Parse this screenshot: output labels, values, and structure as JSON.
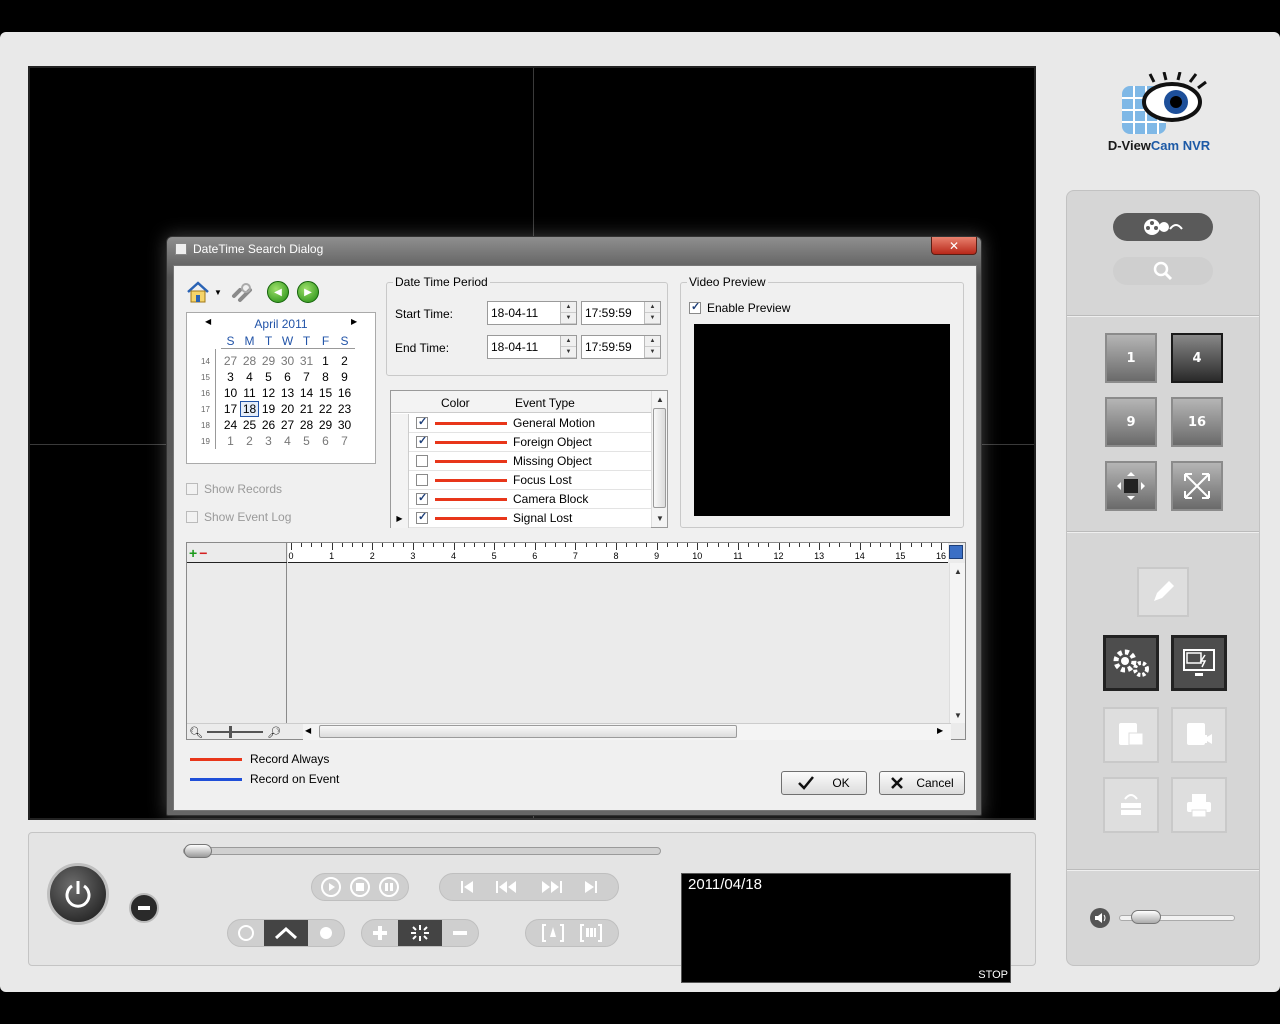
{
  "app": {
    "brand": {
      "name_prefix": "D-View",
      "name_cam": "Cam",
      "name_nvr": " NVR"
    },
    "status": {
      "date": "2011/04/18",
      "state": "STOP"
    },
    "layout_buttons": [
      "1",
      "4",
      "9",
      "16"
    ]
  },
  "dialog": {
    "title": "DateTime Search Dialog",
    "close_label": "✕",
    "calendar": {
      "month_label": "April 2011",
      "dow": [
        "S",
        "M",
        "T",
        "W",
        "T",
        "F",
        "S"
      ],
      "weeks": [
        {
          "wk": "14",
          "days": [
            "27",
            "28",
            "29",
            "30",
            "31",
            "1",
            "2"
          ]
        },
        {
          "wk": "15",
          "days": [
            "3",
            "4",
            "5",
            "6",
            "7",
            "8",
            "9"
          ]
        },
        {
          "wk": "16",
          "days": [
            "10",
            "11",
            "12",
            "13",
            "14",
            "15",
            "16"
          ]
        },
        {
          "wk": "17",
          "days": [
            "17",
            "18",
            "19",
            "20",
            "21",
            "22",
            "23"
          ]
        },
        {
          "wk": "18",
          "days": [
            "24",
            "25",
            "26",
            "27",
            "28",
            "29",
            "30"
          ]
        },
        {
          "wk": "19",
          "days": [
            "1",
            "2",
            "3",
            "4",
            "5",
            "6",
            "7"
          ]
        }
      ],
      "selected_day": "18"
    },
    "options": {
      "show_records": "Show Records",
      "show_event_log": "Show Event Log"
    },
    "datetime": {
      "group_label": "Date Time Period",
      "start_label": "Start Time:",
      "end_label": "End Time:",
      "start_date": "18-04-11",
      "start_time": "17:59:59",
      "end_date": "18-04-11",
      "end_time": "17:59:59"
    },
    "events": {
      "col_color": "Color",
      "col_type": "Event Type",
      "rows": [
        {
          "name": "General Motion",
          "checked": true
        },
        {
          "name": "Foreign Object",
          "checked": true
        },
        {
          "name": "Missing Object",
          "checked": false
        },
        {
          "name": "Focus Lost",
          "checked": false
        },
        {
          "name": "Camera Block",
          "checked": true
        },
        {
          "name": "Signal Lost",
          "checked": true
        }
      ]
    },
    "preview": {
      "group_label": "Video Preview",
      "enable_label": "Enable Preview",
      "enabled": true
    },
    "timeline": {
      "add_label": "+",
      "remove_label": "−",
      "hours": [
        "0",
        "1",
        "2",
        "3",
        "4",
        "5",
        "6",
        "7",
        "8",
        "9",
        "10",
        "11",
        "12",
        "13",
        "14",
        "15",
        "16"
      ]
    },
    "legend": {
      "record_always": "Record Always",
      "record_on_event": "Record on Event",
      "always_color": "#e8361a",
      "event_color": "#1f4fd8"
    },
    "buttons": {
      "ok": "OK",
      "cancel": "Cancel"
    }
  }
}
